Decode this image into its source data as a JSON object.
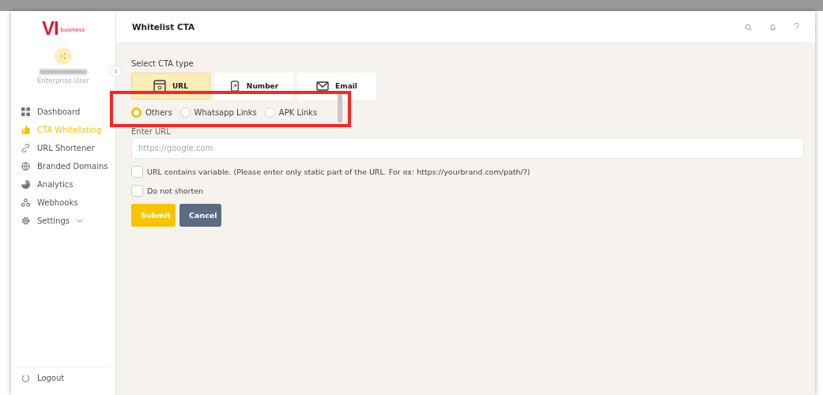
{
  "logo": {
    "mark": "VI",
    "tagline": "business"
  },
  "user": {
    "role": "Enterprise User"
  },
  "sidebar": {
    "items": [
      {
        "label": "Dashboard",
        "selected": false
      },
      {
        "label": "CTA Whitelisting",
        "selected": true
      },
      {
        "label": "URL Shortener",
        "selected": false
      },
      {
        "label": "Branded Domains",
        "selected": false
      },
      {
        "label": "Analytics",
        "selected": false
      },
      {
        "label": "Webhooks",
        "selected": false
      },
      {
        "label": "Settings",
        "selected": false,
        "expandable": true
      }
    ],
    "logout": "Logout"
  },
  "header": {
    "title": "Whitelist CTA"
  },
  "form": {
    "type_label": "Select CTA type",
    "types": [
      {
        "label": "URL",
        "selected": true
      },
      {
        "label": "Number",
        "selected": false
      },
      {
        "label": "Email",
        "selected": false
      }
    ],
    "radios": [
      {
        "label": "Others",
        "selected": true
      },
      {
        "label": "Whatsapp Links",
        "selected": false
      },
      {
        "label": "APK Links",
        "selected": false
      }
    ],
    "url_label": "Enter URL",
    "url_placeholder": "https://google.com",
    "checkboxes": [
      {
        "label": "URL contains variable. (Please enter only static part of the URL. For ex: https://yourbrand.com/path/?)",
        "checked": false
      },
      {
        "label": "Do not shorten",
        "checked": false
      }
    ],
    "buttons": [
      {
        "label": "Submit",
        "kind": "primary"
      },
      {
        "label": "Cancel",
        "kind": "secondary"
      }
    ]
  },
  "annotation": {
    "kind": "highlight"
  }
}
